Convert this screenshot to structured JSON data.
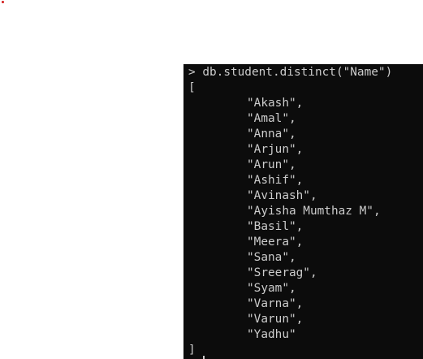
{
  "terminal": {
    "command": "> db.student.distinct(\"Name\")",
    "open_bracket": "[",
    "close_bracket": "]",
    "items": [
      "\"Akash\",",
      "\"Amal\",",
      "\"Anna\",",
      "\"Arjun\",",
      "\"Arun\",",
      "\"Ashif\",",
      "\"Avinash\",",
      "\"Ayisha Mumthaz M\",",
      "\"Basil\",",
      "\"Meera\",",
      "\"Sana\",",
      "\"Sreerag\",",
      "\"Syam\",",
      "\"Varna\",",
      "\"Varun\",",
      "\"Yadhu\""
    ]
  },
  "colors": {
    "terminal_background": "#0c0c0c",
    "terminal_text": "#cccccc",
    "marker_dot": "#d11a1a"
  }
}
